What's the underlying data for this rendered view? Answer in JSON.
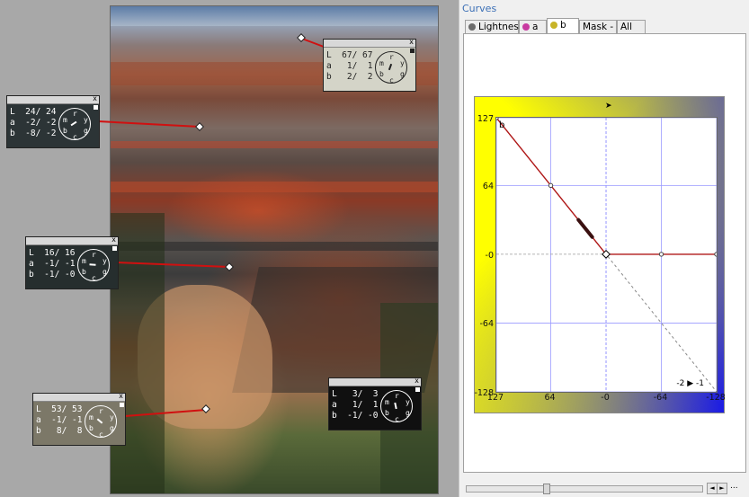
{
  "panel": {
    "title": "Curves",
    "tabs": [
      {
        "label": "Lightness",
        "icon": "lightness-icon",
        "color": "#6a6a6a"
      },
      {
        "label": "a",
        "icon": "a-channel-icon",
        "color": "#c83aa0"
      },
      {
        "label": "b",
        "icon": "b-channel-icon",
        "color": "#c8b428",
        "active": true
      },
      {
        "label": "Mask - L"
      },
      {
        "label": "All"
      }
    ],
    "channel_letter": "b",
    "mode_label": "-2 ▶ -1"
  },
  "chart_data": {
    "type": "line",
    "xlabel": "",
    "ylabel": "",
    "x_ticks": [
      "127",
      "64",
      "-0",
      "-64",
      "-128"
    ],
    "y_ticks": [
      "-128",
      "-64",
      "-0",
      "64",
      "127"
    ],
    "xlim": [
      127,
      -128
    ],
    "ylim": [
      127,
      -128
    ],
    "grid": true,
    "series": [
      {
        "x": [
          127,
          64,
          0,
          -64,
          -128
        ],
        "y": [
          127,
          64,
          0,
          0,
          0
        ]
      }
    ],
    "identity": {
      "x": [
        127,
        -128
      ],
      "y": [
        127,
        -128
      ]
    },
    "histogram_peak_at": 0,
    "colors": {
      "curve": "#b01818",
      "identity": "#888888",
      "neutral": "#7a7aff",
      "histogram": "#b8b8b8"
    }
  },
  "samplers": [
    {
      "l": "L  67/ 67",
      "a": "a   1/  1",
      "b": "b   2/  2",
      "bg": "#d4d4c8",
      "fg": "#222222"
    },
    {
      "l": "L  24/ 24",
      "a": "a  -2/ -2",
      "b": "b  -8/ -2",
      "bg": "#2c3436",
      "fg": "#ffffff"
    },
    {
      "l": "L  16/ 16",
      "a": "a  -1/ -1",
      "b": "b  -1/ -0",
      "bg": "#262e2e",
      "fg": "#ffffff"
    },
    {
      "l": "L  53/ 53",
      "a": "a  -1/ -1",
      "b": "b   8/  8",
      "bg": "#7c7868",
      "fg": "#ffffff"
    },
    {
      "l": "L   3/  3",
      "a": "a   1/  1",
      "b": "b  -1/ -0",
      "bg": "#101010",
      "fg": "#ffffff"
    }
  ],
  "wheel_letters": {
    "m": "m",
    "r": "r",
    "y": "y",
    "g": "g",
    "c": "c",
    "b": "b"
  },
  "close_glyph": "x",
  "scroll": {
    "left": "◄",
    "right": "►",
    "menu": "..."
  }
}
